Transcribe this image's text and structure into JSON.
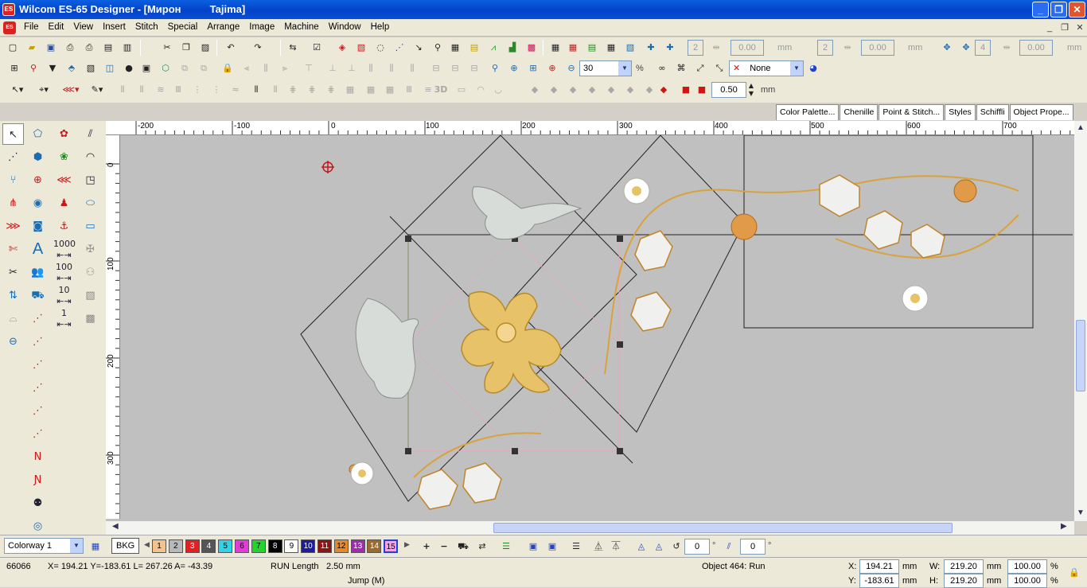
{
  "window": {
    "title": "Wilcom ES-65 Designer - [Мирон          Tajima]",
    "app_icon": "ES",
    "minimize": "_",
    "maximize": "❐",
    "close": "✕"
  },
  "menu": [
    "File",
    "Edit",
    "View",
    "Insert",
    "Stitch",
    "Special",
    "Arrange",
    "Image",
    "Machine",
    "Window",
    "Help"
  ],
  "toolbar1": {
    "spin_a": "2",
    "val_a": "0.00",
    "unit_a": "mm",
    "spin_b": "2",
    "val_b": "0.00",
    "unit_b": "mm",
    "spin_c": "4",
    "val_c": "0.00",
    "unit_c": "mm"
  },
  "toolbar2": {
    "zoom_value": "30",
    "zoom_unit": "%",
    "fill_value": "None"
  },
  "toolbar3": {
    "width_value": "0.50",
    "width_unit": "mm",
    "label_3d": "3D"
  },
  "doc_tabs": [
    "Color Palette...",
    "Chenille",
    "Point & Stitch...",
    "Styles",
    "Schiffli",
    "Object Prope..."
  ],
  "ruler": {
    "h": [
      "-200",
      "-100",
      "0",
      "100",
      "200",
      "300",
      "400",
      "500",
      "600",
      "700"
    ],
    "v": [
      "0",
      "100",
      "200",
      "300"
    ]
  },
  "toolbox": {
    "label_1000": "1000",
    "label_100": "100",
    "label_10": "10",
    "label_1": "1"
  },
  "colorbar": {
    "colorway": "Colorway 1",
    "bkg": "BKG",
    "swatches": [
      {
        "n": "1",
        "color": "#f5c28a"
      },
      {
        "n": "2",
        "color": "#b8b8b8"
      },
      {
        "n": "3",
        "color": "#e51f1f"
      },
      {
        "n": "4",
        "color": "#555555"
      },
      {
        "n": "5",
        "color": "#2fd3e6"
      },
      {
        "n": "6",
        "color": "#e43ad9"
      },
      {
        "n": "7",
        "color": "#22d42b"
      },
      {
        "n": "8",
        "color": "#000000"
      },
      {
        "n": "9",
        "color": "#ffffff"
      },
      {
        "n": "10",
        "color": "#1c1c9c"
      },
      {
        "n": "11",
        "color": "#8a1515"
      },
      {
        "n": "12",
        "color": "#e58a2a"
      },
      {
        "n": "13",
        "color": "#9c2db0"
      },
      {
        "n": "14",
        "color": "#9a6a2e"
      },
      {
        "n": "15",
        "color": "#f4a3e8"
      }
    ],
    "angle1": "0",
    "angle2": "0",
    "deg": "°"
  },
  "status": {
    "count": "66066",
    "coords": "X= 194.21 Y=-183.61 L= 267.26 A= -43.39",
    "run_length_label": "RUN Length",
    "run_length_value": "2.50 mm",
    "jump": "Jump (M)",
    "object": "Object 464: Run",
    "x_label": "X:",
    "x_value": "194.21",
    "y_label": "Y:",
    "y_value": "-183.61",
    "w_label": "W:",
    "w_value": "219.20",
    "h_label": "H:",
    "h_value": "219.20",
    "mm": "mm",
    "pct_w": "100.00",
    "pct_h": "100.00",
    "pct": "%"
  }
}
